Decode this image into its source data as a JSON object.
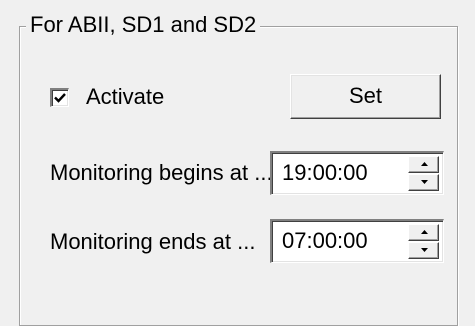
{
  "group": {
    "title": "For ABII, SD1 and SD2"
  },
  "activate": {
    "label": "Activate",
    "checked": true
  },
  "set_button": {
    "label": "Set"
  },
  "monitoring": {
    "begin_label": "Monitoring begins at ...",
    "begin_value": "19:00:00",
    "end_label": "Monitoring ends at ...",
    "end_value": "07:00:00"
  },
  "icons": {
    "checkmark": "check-icon",
    "spin_up": "arrow-up-icon",
    "spin_down": "arrow-down-icon"
  },
  "colors": {
    "background": "#f0f0f0",
    "field_background": "#ffffff",
    "text": "#000000",
    "border_shadow": "#808080"
  }
}
